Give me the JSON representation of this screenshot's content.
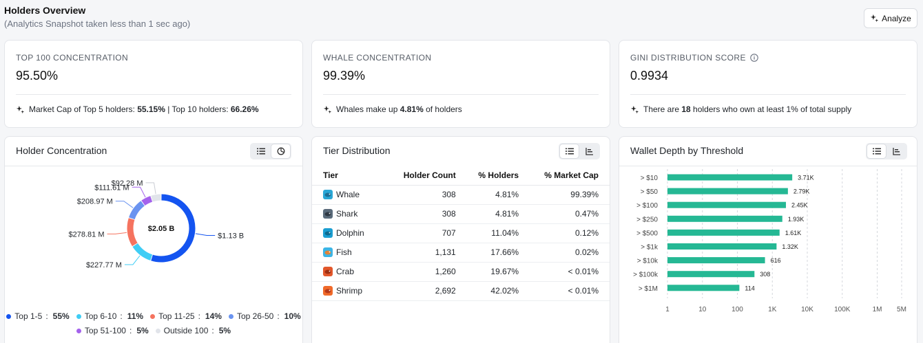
{
  "header": {
    "title": "Holders Overview",
    "subtitle": "(Analytics Snapshot taken less than 1 sec ago)",
    "analyze_label": "Analyze"
  },
  "stats": [
    {
      "label": "TOP 100 CONCENTRATION",
      "value": "95.50%",
      "note_parts": [
        "Market Cap of Top 5 holders: ",
        "55.15%",
        " | Top 10 holders: ",
        "66.26%"
      ]
    },
    {
      "label": "WHALE CONCENTRATION",
      "value": "99.39%",
      "note_parts": [
        "Whales make up ",
        "4.81%",
        " of holders",
        ""
      ]
    },
    {
      "label": "GINI DISTRIBUTION SCORE",
      "value": "0.9934",
      "note_parts": [
        "There are ",
        "18",
        " holders who own at least 1% of total supply",
        ""
      ]
    }
  ],
  "holder_concentration": {
    "title": "Holder Concentration",
    "center_label": "$2.05 B",
    "chart_data": {
      "type": "pie",
      "categories": [
        "Top 1-5",
        "Top 6-10",
        "Top 11-25",
        "Top 26-50",
        "Top 51-100",
        "Outside 100"
      ],
      "values": [
        55,
        11,
        14,
        10,
        5,
        5
      ],
      "value_labels": [
        "$1.13 B",
        "$227.77 M",
        "$278.81 M",
        "$208.97 M",
        "$111.61 M",
        "$92.28 M"
      ],
      "percent_labels": [
        "55%",
        "11%",
        "14%",
        "10%",
        "5%",
        "5%"
      ],
      "colors": [
        "#1454f0",
        "#3fcdf5",
        "#f5735f",
        "#6a93f0",
        "#a462ec",
        "#e1e4ea"
      ]
    }
  },
  "tier_distribution": {
    "title": "Tier Distribution",
    "columns": [
      "Tier",
      "Holder Count",
      "% Holders",
      "% Market Cap"
    ],
    "rows": [
      {
        "icon": "whale-icon",
        "name": "Whale",
        "count": "308",
        "pct_holders": "4.81%",
        "pct_mcap": "99.39%"
      },
      {
        "icon": "shark-icon",
        "name": "Shark",
        "count": "308",
        "pct_holders": "4.81%",
        "pct_mcap": "0.47%"
      },
      {
        "icon": "dolphin-icon",
        "name": "Dolphin",
        "count": "707",
        "pct_holders": "11.04%",
        "pct_mcap": "0.12%"
      },
      {
        "icon": "fish-icon",
        "name": "Fish",
        "count": "1,131",
        "pct_holders": "17.66%",
        "pct_mcap": "0.02%"
      },
      {
        "icon": "crab-icon",
        "name": "Crab",
        "count": "1,260",
        "pct_holders": "19.67%",
        "pct_mcap": "< 0.01%"
      },
      {
        "icon": "shrimp-icon",
        "name": "Shrimp",
        "count": "2,692",
        "pct_holders": "42.02%",
        "pct_mcap": "< 0.01%"
      }
    ]
  },
  "wallet_depth": {
    "title": "Wallet Depth by Threshold",
    "chart_data": {
      "type": "bar",
      "orientation": "horizontal",
      "scale": "log",
      "categories": [
        "> $10",
        "> $50",
        "> $100",
        "> $250",
        "> $500",
        "> $1k",
        "> $10k",
        "> $100k",
        "> $1M"
      ],
      "values": [
        3710,
        2790,
        2450,
        1930,
        1610,
        1320,
        616,
        308,
        114
      ],
      "value_labels": [
        "3.71K",
        "2.79K",
        "2.45K",
        "1.93K",
        "1.61K",
        "1.32K",
        "616",
        "308",
        "114"
      ],
      "x_ticks": [
        1,
        10,
        100,
        1000,
        10000,
        100000,
        1000000,
        5000000
      ],
      "x_tick_labels": [
        "1",
        "10",
        "100",
        "1K",
        "10K",
        "100K",
        "1M",
        "5M"
      ],
      "xlim": [
        1,
        5000000
      ],
      "grid": true,
      "bar_color": "#25b894"
    }
  },
  "colors": {
    "accent": "#1454f0",
    "bar": "#25b894"
  }
}
